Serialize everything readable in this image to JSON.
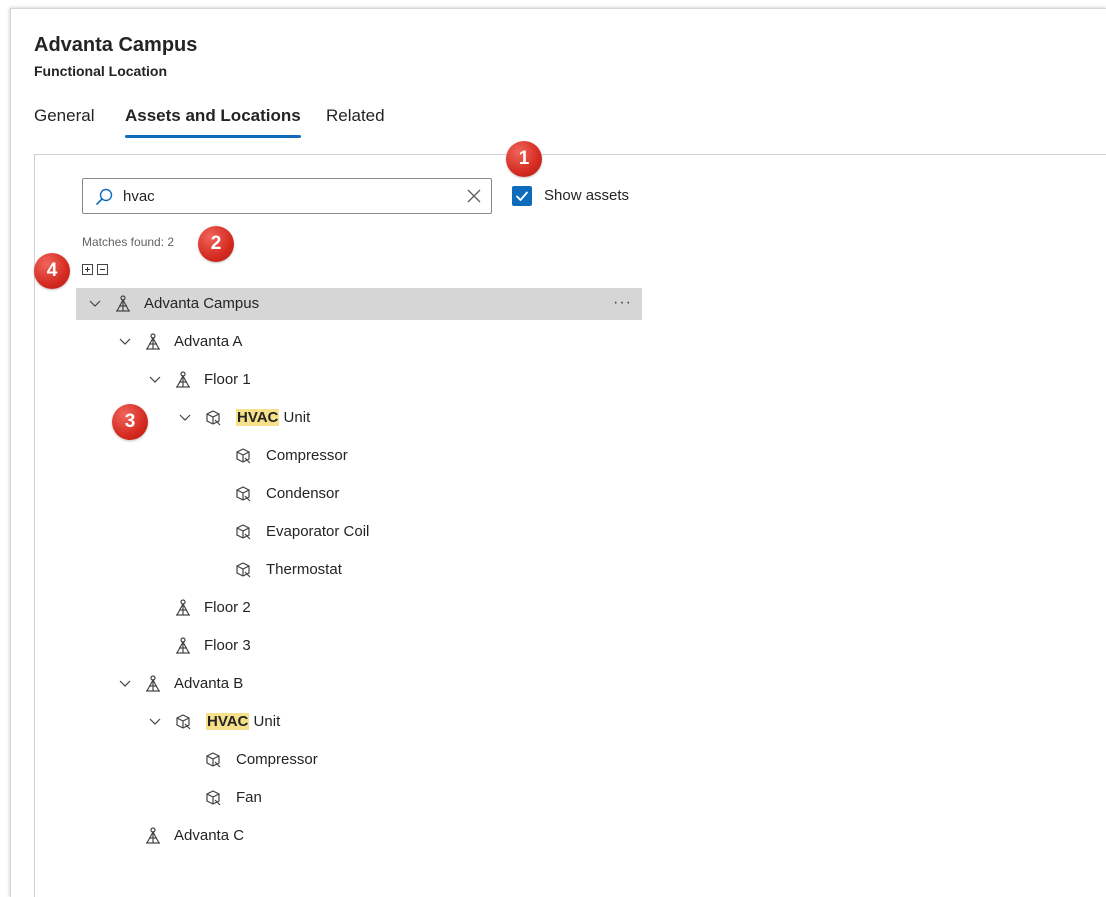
{
  "record": {
    "title": "Advanta Campus",
    "subtitle": "Functional Location"
  },
  "tabs": [
    {
      "label": "General",
      "active": false
    },
    {
      "label": "Assets and Locations",
      "active": true
    },
    {
      "label": "Related",
      "active": false
    }
  ],
  "search": {
    "value": "hvac",
    "placeholder": ""
  },
  "show_assets": {
    "label": "Show assets",
    "checked": true
  },
  "matches_text": "Matches found: 2",
  "tree": {
    "root": "Advanta Campus",
    "advanta_a": "Advanta A",
    "floor1": "Floor 1",
    "hvac_a_highlight": "HVAC",
    "hvac_a_rest": " Unit",
    "compressor_a": "Compressor",
    "condensor": "Condensor",
    "evaporator": "Evaporator Coil",
    "thermostat": "Thermostat",
    "floor2": "Floor 2",
    "floor3": "Floor 3",
    "advanta_b": "Advanta B",
    "hvac_b_highlight": "HVAC",
    "hvac_b_rest": " Unit",
    "compressor_b": "Compressor",
    "fan": "Fan",
    "advanta_c": "Advanta C"
  },
  "more_glyph": "···",
  "badges": [
    "1",
    "2",
    "3",
    "4"
  ],
  "colors": {
    "accent": "#0f6cbd",
    "highlight": "#f6e08a",
    "badge": "#d52b21",
    "selected_row": "#d6d6d6"
  }
}
